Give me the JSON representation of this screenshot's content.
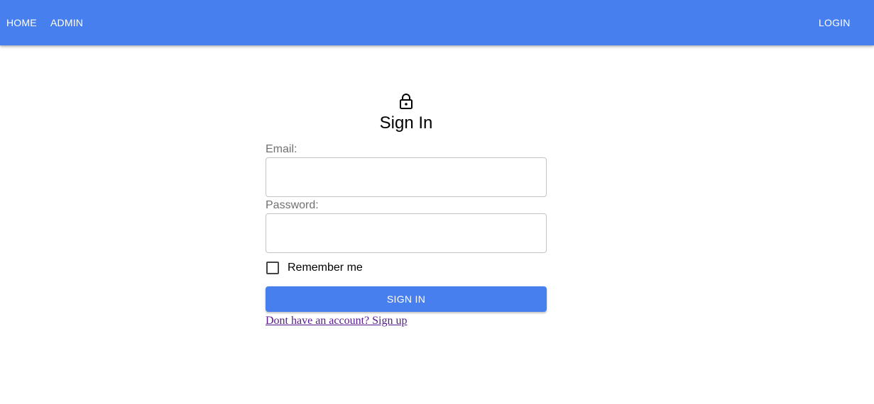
{
  "navbar": {
    "background": "#4780ee",
    "items": [
      {
        "label": "HOME"
      },
      {
        "label": "ADMIN"
      }
    ],
    "login_label": "LOGIN"
  },
  "form": {
    "icon": "lock-icon",
    "title": "Sign In",
    "email_label": "Email:",
    "email_value": "",
    "password_label": "Password:",
    "password_value": "",
    "remember_label": "Remember me",
    "remember_checked": false,
    "submit_label": "SIGN IN",
    "signup_link_text": "Dont have an account? Sign up"
  },
  "colors": {
    "accent": "#4780ee",
    "link_visited": "#551a8b",
    "label_gray": "#707070"
  }
}
